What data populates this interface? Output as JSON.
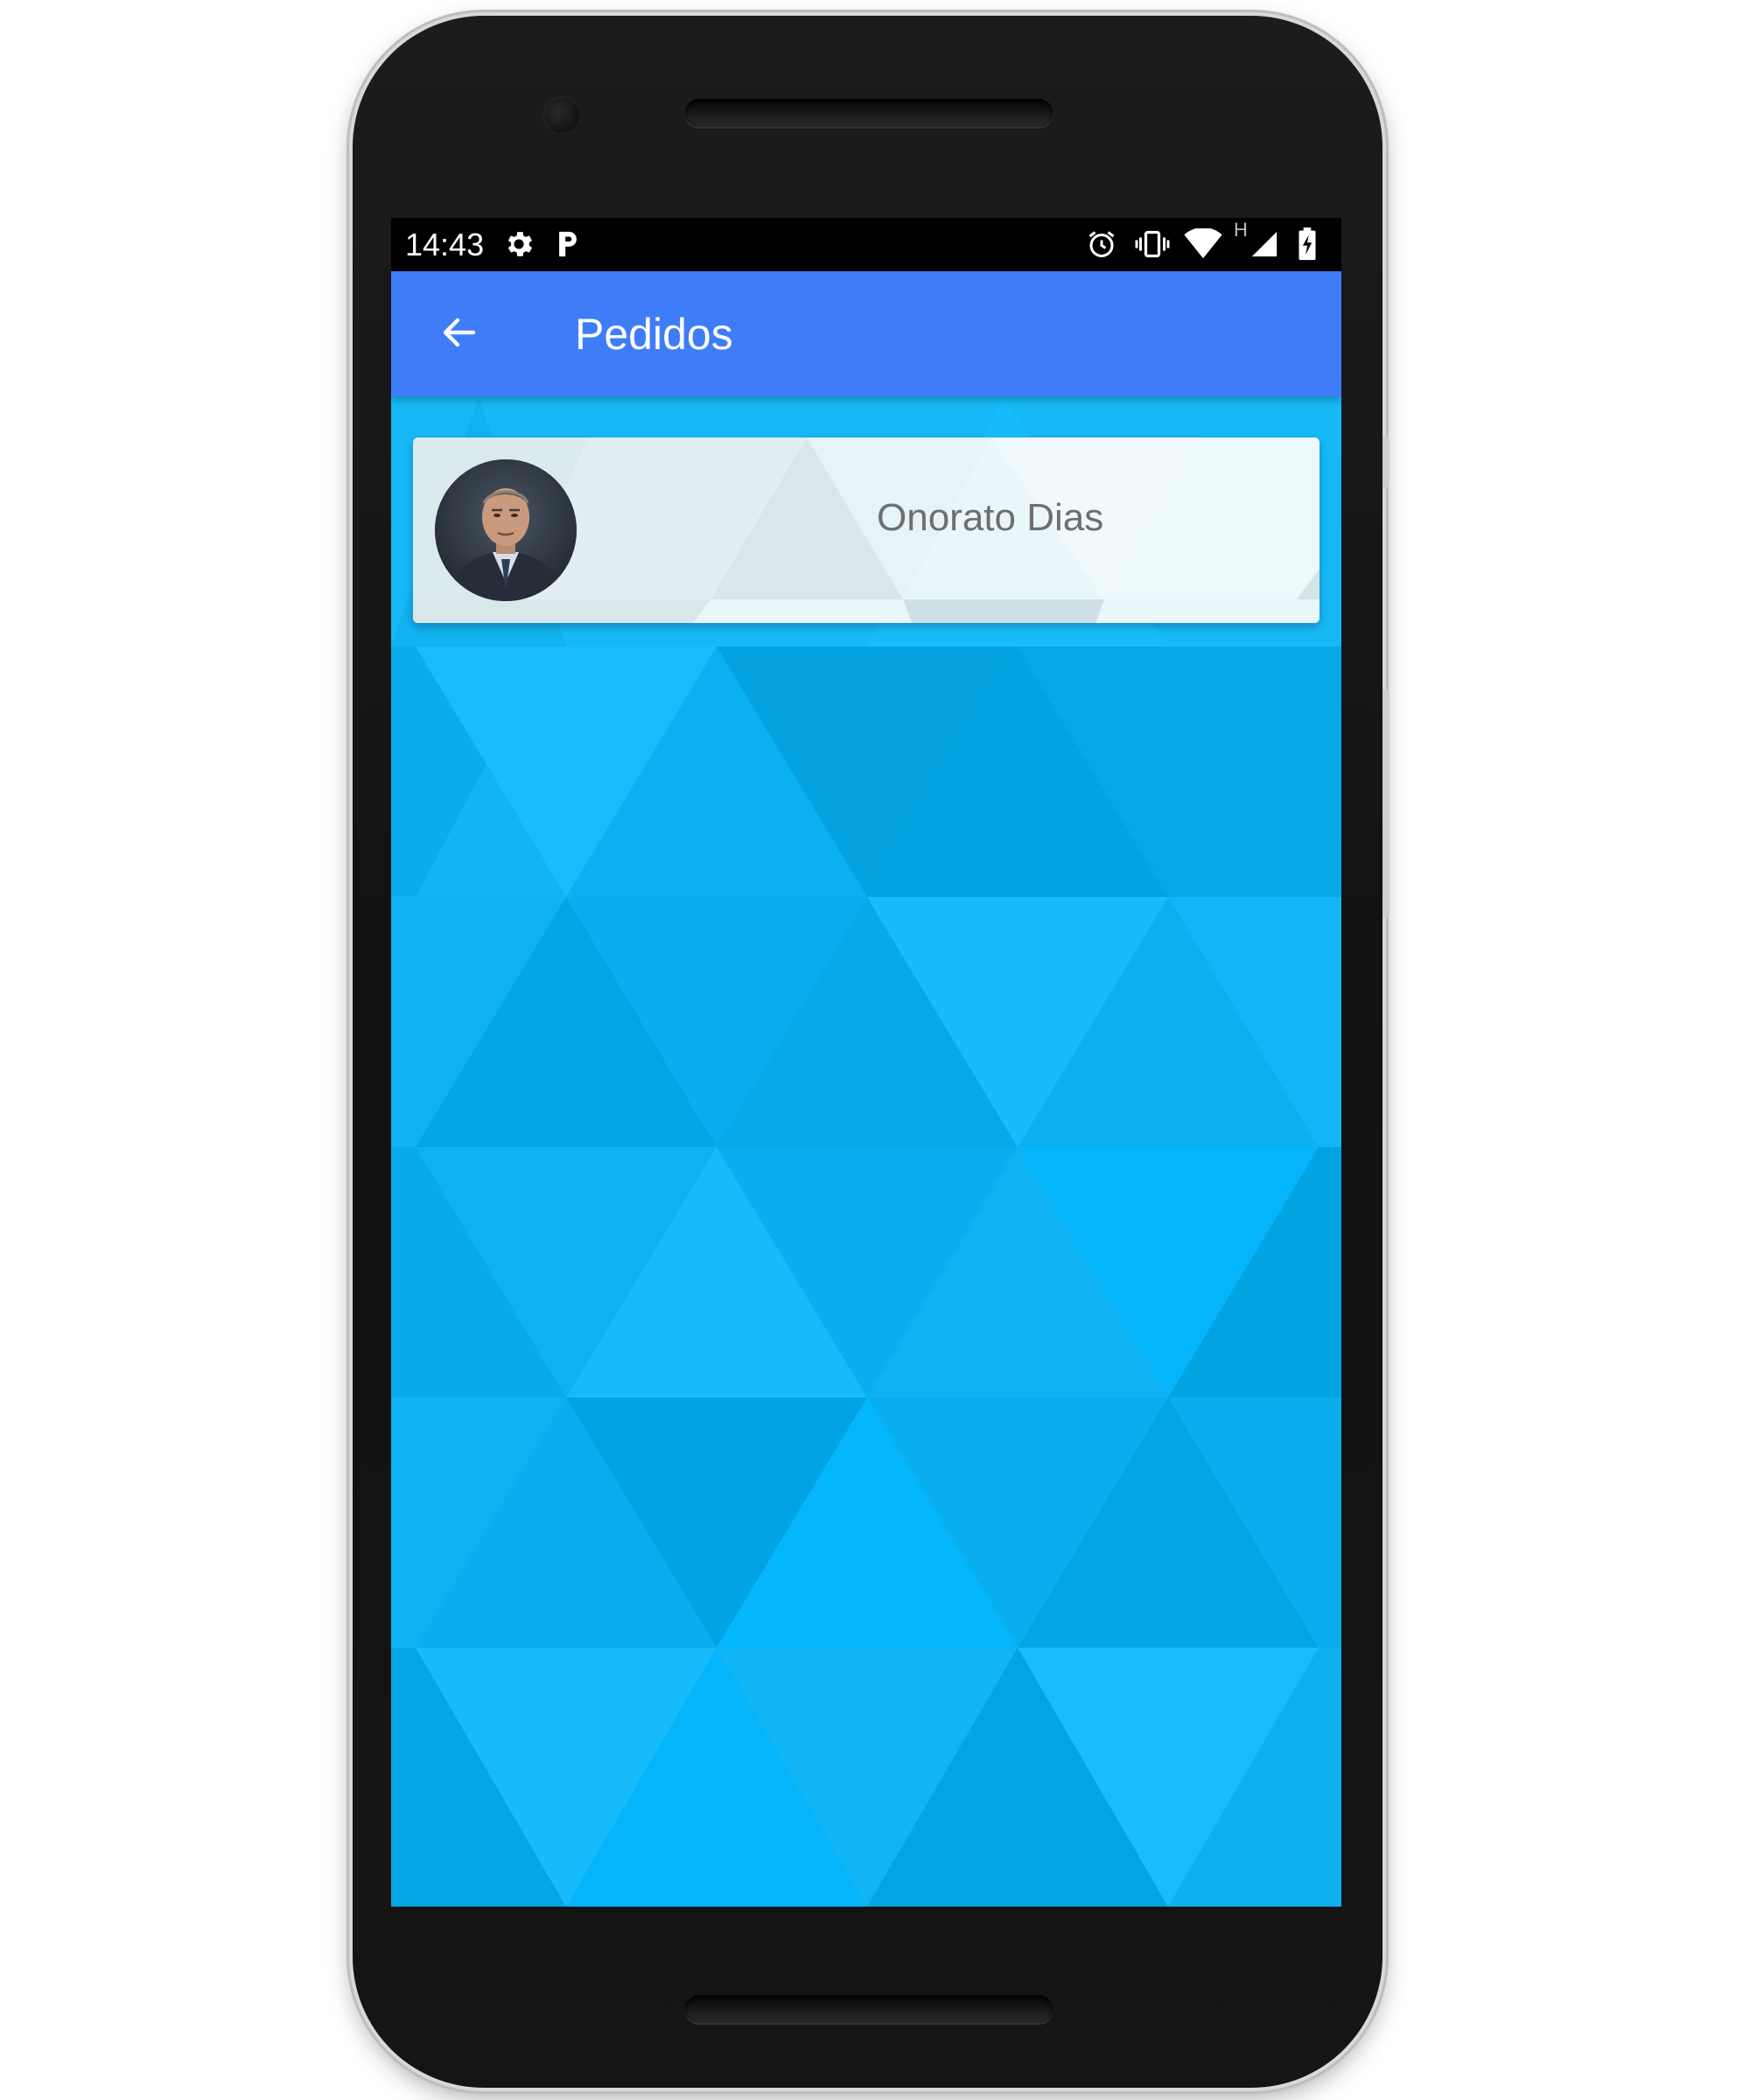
{
  "status_bar": {
    "time": "14:43",
    "left_icons": [
      "settings-gear-icon",
      "parking-app-icon"
    ],
    "right_icons": [
      "alarm-icon",
      "vibrate-icon",
      "wifi-icon",
      "network-type-h-icon",
      "cell-signal-icon",
      "battery-charging-icon"
    ],
    "network_type": "H"
  },
  "app_bar": {
    "title": "Pedidos",
    "back_icon": "arrow-back-icon",
    "color": "#3e7df7"
  },
  "list": {
    "items": [
      {
        "name": "Onorato Dias",
        "avatar": "profile-photo"
      }
    ]
  },
  "colors": {
    "background_primary": "#12b4f3",
    "card_background": "#e6f4f8",
    "card_text": "#6d6f70"
  }
}
